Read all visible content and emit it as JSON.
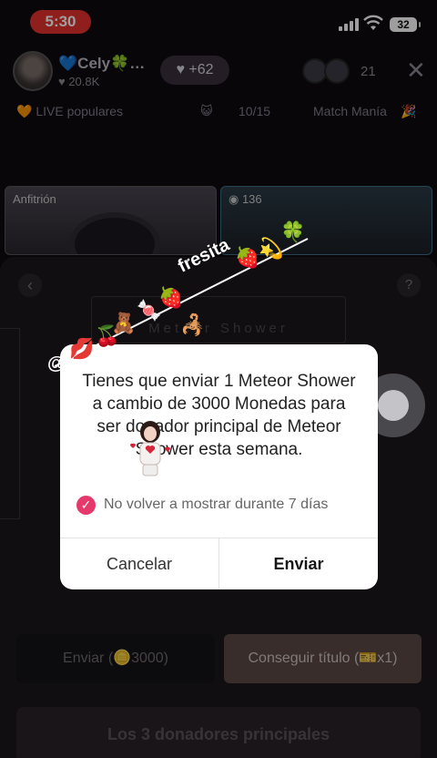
{
  "status_bar": {
    "time": "5:30",
    "battery": "32"
  },
  "header": {
    "host_name": "💙Cely🍀…",
    "host_followers": "♥ 20.8K",
    "likes": "♥ +62",
    "viewer_count": "21",
    "close_icon": "close-icon"
  },
  "tags": {
    "live_popular": "🧡 LIVE populares",
    "rank": "10/15",
    "match": "Match Manía"
  },
  "tiles": {
    "left_label": "Anfitrión",
    "right_label": "◉ 136"
  },
  "sheet": {
    "gift_name": "Meteor Shower",
    "send_label": "Enviar (🪙3000)",
    "title_label": "Conseguir título (🎫x1)",
    "top_donors": "Los 3 donadores principales"
  },
  "dialog": {
    "message": "Tienes que enviar 1 Meteor Shower a cambio de 3000 Monedas para ser donador principal de Meteor Shower esta semana.",
    "checkbox_label": "No volver a mostrar durante 7 días",
    "checked": true,
    "cancel": "Cancelar",
    "confirm": "Enviar"
  },
  "sticker": {
    "text": "fresita",
    "at": "@"
  },
  "colors": {
    "status_pill": "#e6322f",
    "checkbox": "#e6396b",
    "dialog_bg": "#ffffff",
    "sheet_bg": "#1b181c"
  }
}
